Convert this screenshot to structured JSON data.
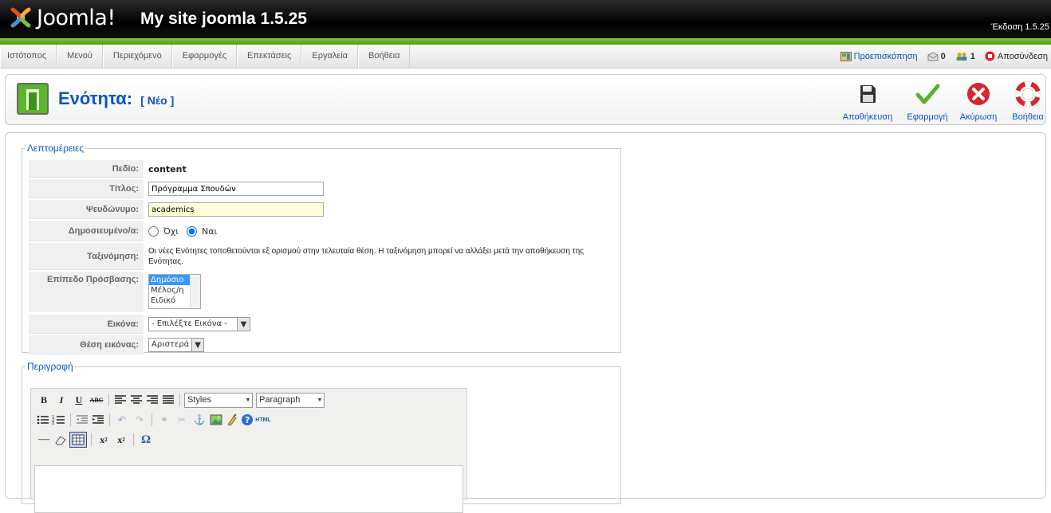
{
  "header": {
    "logo_text": "Joomla!",
    "site_name": "My site joomla 1.5.25",
    "version": "Έκδοση 1.5.25"
  },
  "menu": {
    "items": [
      "Ιστότοπος",
      "Μενού",
      "Περιεχόμενο",
      "Εφαρμογές",
      "Επεκτάσεις",
      "Εργαλεία",
      "Βοήθεια"
    ]
  },
  "status": {
    "preview": "Προεπισκόπηση",
    "messages_count": "0",
    "users_count": "1",
    "logout": "Αποσύνδεση"
  },
  "toolbar": {
    "title": "Ενότητα:",
    "subtitle": "[ Νέο ]",
    "save": "Αποθήκευση",
    "apply": "Εφαρμογή",
    "cancel": "Ακύρωση",
    "help": "Βοήθεια"
  },
  "details": {
    "legend": "Λεπτομέρειες",
    "scope_label": "Πεδίο:",
    "scope_value": "content",
    "title_label": "Τίτλος:",
    "title_value": "Πρόγραμμα Σπουδών",
    "alias_label": "Ψευδώνυμο:",
    "alias_value": "academics",
    "published_label": "Δημοσιευμένο/α:",
    "published_no": "Όχι",
    "published_yes": "Ναι",
    "ordering_label": "Ταξινόμηση:",
    "ordering_text": "Οι νέες Ενότητες τοποθετούνται εξ ορισμού στην τελευταία θέση. Η ταξινόμηση μπορεί να αλλάξει μετά την αποθήκευση της Ενότητας.",
    "access_label": "Επίπεδο Πρόσβασης:",
    "access_options": [
      "Δημόσιο",
      "Μέλος/η",
      "Ειδικό"
    ],
    "image_label": "Εικόνα:",
    "image_value": "- Επιλέξτε Εικόνα -",
    "image_pos_label": "Θέση εικόνας:",
    "image_pos_value": "Αριστερά"
  },
  "description": {
    "legend": "Περιγραφή",
    "styles": "Styles",
    "format": "Paragraph",
    "html_label": "HTML"
  },
  "colors": {
    "link": "#0b55c4",
    "green": "#6ab82a"
  }
}
